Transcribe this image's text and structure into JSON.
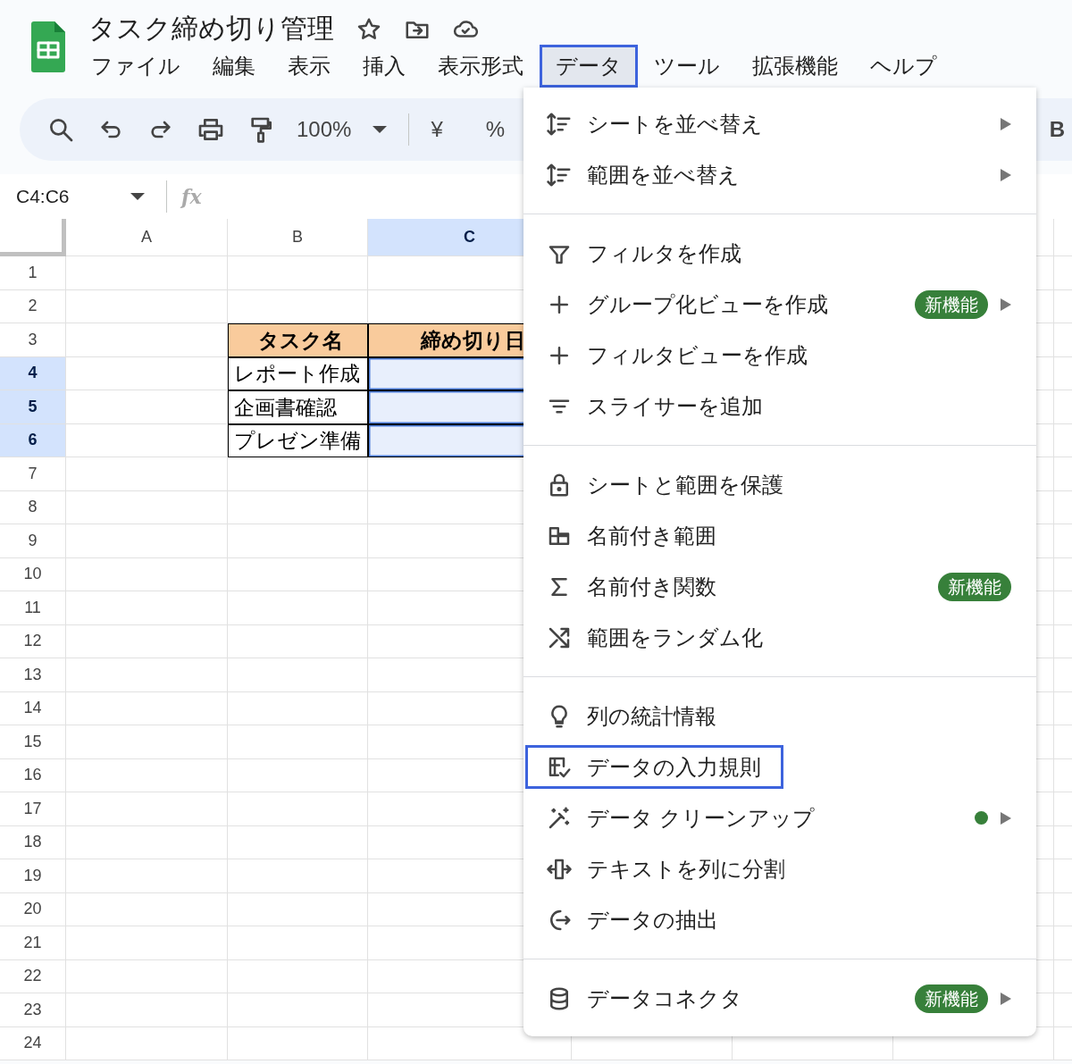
{
  "document": {
    "title": "タスク締め切り管理"
  },
  "menu_bar": [
    {
      "label": "ファイル",
      "selected": false
    },
    {
      "label": "編集",
      "selected": false
    },
    {
      "label": "表示",
      "selected": false
    },
    {
      "label": "挿入",
      "selected": false
    },
    {
      "label": "表示形式",
      "selected": false
    },
    {
      "label": "データ",
      "selected": true
    },
    {
      "label": "ツール",
      "selected": false
    },
    {
      "label": "拡張機能",
      "selected": false
    },
    {
      "label": "ヘルプ",
      "selected": false
    }
  ],
  "toolbar": {
    "zoom": "100%",
    "currency": "¥",
    "percent": "%",
    "bold": "B"
  },
  "name_box": "C4:C6",
  "formula_label": "fx",
  "columns": [
    {
      "label": "A",
      "selected": false
    },
    {
      "label": "B",
      "selected": false
    },
    {
      "label": "C",
      "selected": true
    }
  ],
  "rows": [
    {
      "label": "1",
      "selected": false
    },
    {
      "label": "2",
      "selected": false
    },
    {
      "label": "3",
      "selected": false
    },
    {
      "label": "4",
      "selected": true
    },
    {
      "label": "5",
      "selected": true
    },
    {
      "label": "6",
      "selected": true
    },
    {
      "label": "7",
      "selected": false
    },
    {
      "label": "8",
      "selected": false
    },
    {
      "label": "9",
      "selected": false
    },
    {
      "label": "10",
      "selected": false
    },
    {
      "label": "11",
      "selected": false
    },
    {
      "label": "12",
      "selected": false
    },
    {
      "label": "13",
      "selected": false
    },
    {
      "label": "14",
      "selected": false
    },
    {
      "label": "15",
      "selected": false
    },
    {
      "label": "16",
      "selected": false
    },
    {
      "label": "17",
      "selected": false
    },
    {
      "label": "18",
      "selected": false
    },
    {
      "label": "19",
      "selected": false
    },
    {
      "label": "20",
      "selected": false
    },
    {
      "label": "21",
      "selected": false
    },
    {
      "label": "22",
      "selected": false
    },
    {
      "label": "23",
      "selected": false
    },
    {
      "label": "24",
      "selected": false
    }
  ],
  "task_table": {
    "headers": [
      "タスク名",
      "締め切り日"
    ],
    "tasks": [
      "レポート作成",
      "企画書確認",
      "プレゼン準備"
    ]
  },
  "data_menu": {
    "sections": [
      {
        "items": [
          {
            "label": "シートを並べ替え",
            "submenu": true,
            "dot": false,
            "selected": false
          },
          {
            "label": "範囲を並べ替え",
            "submenu": true,
            "dot": false,
            "selected": false
          }
        ]
      },
      {
        "items": [
          {
            "label": "フィルタを作成",
            "submenu": false,
            "dot": false,
            "selected": false
          },
          {
            "label": "グループ化ビューを作成",
            "badge": "新機能",
            "submenu": true,
            "dot": false,
            "selected": false
          },
          {
            "label": "フィルタビューを作成",
            "submenu": false,
            "dot": false,
            "selected": false
          },
          {
            "label": "スライサーを追加",
            "submenu": false,
            "dot": false,
            "selected": false
          }
        ]
      },
      {
        "items": [
          {
            "label": "シートと範囲を保護",
            "submenu": false,
            "dot": false,
            "selected": false
          },
          {
            "label": "名前付き範囲",
            "submenu": false,
            "dot": false,
            "selected": false
          },
          {
            "label": "名前付き関数",
            "badge": "新機能",
            "submenu": false,
            "dot": false,
            "selected": false
          },
          {
            "label": "範囲をランダム化",
            "submenu": false,
            "dot": false,
            "selected": false
          }
        ]
      },
      {
        "items": [
          {
            "label": "列の統計情報",
            "submenu": false,
            "dot": false,
            "selected": false
          },
          {
            "label": "データの入力規則",
            "submenu": false,
            "dot": false,
            "selected": true
          },
          {
            "label": "データ クリーンアップ",
            "submenu": true,
            "dot": true,
            "selected": false
          },
          {
            "label": "テキストを列に分割",
            "submenu": false,
            "dot": false,
            "selected": false
          },
          {
            "label": "データの抽出",
            "submenu": false,
            "dot": false,
            "selected": false
          }
        ]
      },
      {
        "items": [
          {
            "label": "データコネクタ",
            "badge": "新機能",
            "submenu": true,
            "dot": false,
            "selected": false
          }
        ]
      }
    ]
  }
}
